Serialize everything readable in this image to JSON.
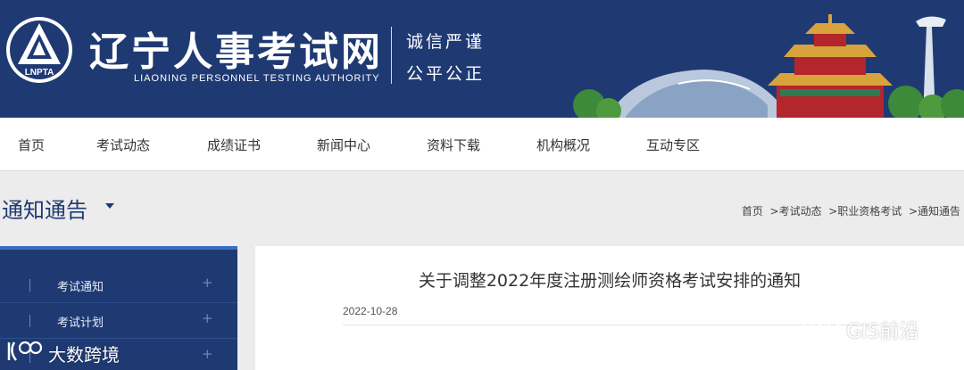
{
  "header": {
    "logo_text": "LNPTA",
    "title": "辽宁人事考试网",
    "subtitle": "LIAONING PERSONNEL TESTING AUTHORITY",
    "motto_line1": "诚信严谨",
    "motto_line2": "公平公正",
    "background_color": "#1f3a73"
  },
  "nav": {
    "items": [
      "首页",
      "考试动态",
      "成绩证书",
      "新闻中心",
      "资料下载",
      "机构概况",
      "互动专区"
    ]
  },
  "section": {
    "title": "通知通告",
    "caret_icon": "caret-down-icon"
  },
  "breadcrumb": {
    "items": [
      "首页",
      ">考试动态",
      ">职业资格考试",
      ">通知通告"
    ]
  },
  "sidebar": {
    "items": [
      {
        "label": "考试通知",
        "expand": "+"
      },
      {
        "label": "考试计划",
        "expand": "+"
      },
      {
        "label": "",
        "expand": "+"
      }
    ],
    "accent_color": "#3a6fc4"
  },
  "article": {
    "title": "关于调整2022年度注册测绘师资格考试安排的通知",
    "date": "2022-10-28"
  },
  "watermarks": {
    "right": "GIS前沿",
    "right_icon": "wechat-icon",
    "left": "大数跨境",
    "left_icon": "brand-logo-icon"
  }
}
